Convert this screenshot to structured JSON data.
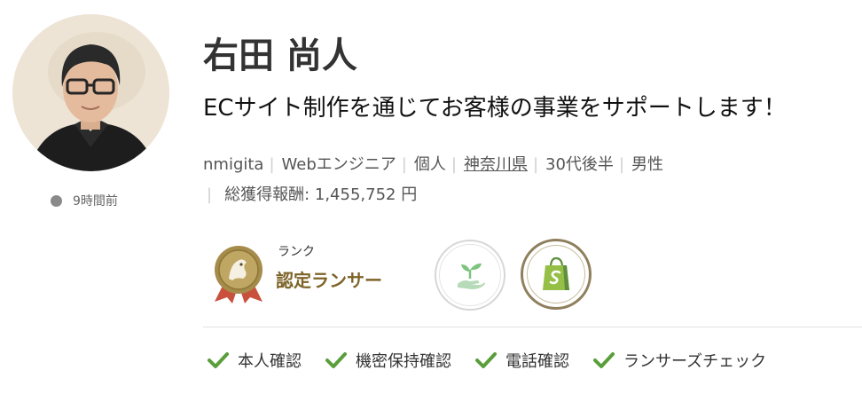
{
  "profile": {
    "name": "右田 尚人",
    "tagline": "ECサイト制作を通じてお客様の事業をサポートします！",
    "last_active": "9時間前",
    "meta": {
      "username": "nmigita",
      "job": "Webエンジニア",
      "type": "個人",
      "location": "神奈川県",
      "age": "30代後半",
      "gender": "男性",
      "earnings": "総獲得報酬: 1,455,752 円",
      "separator": "|"
    }
  },
  "rank": {
    "caption": "ランク",
    "value": "認定ランサー",
    "medal_color": "#a68c4a"
  },
  "badges": [
    {
      "icon": "sprout-hand-icon",
      "color": "#7cc47f"
    },
    {
      "icon": "shopify-bag-icon",
      "color": "#95bf47"
    }
  ],
  "verifications": [
    {
      "label": "本人確認",
      "icon": "check-icon"
    },
    {
      "label": "機密保持確認",
      "icon": "check-icon"
    },
    {
      "label": "電話確認",
      "icon": "check-icon"
    },
    {
      "label": "ランサーズチェック",
      "icon": "check-icon"
    }
  ],
  "colors": {
    "check": "#5a9e3c",
    "rank_text": "#7d6328",
    "status_dot": "#8a8a8a"
  }
}
